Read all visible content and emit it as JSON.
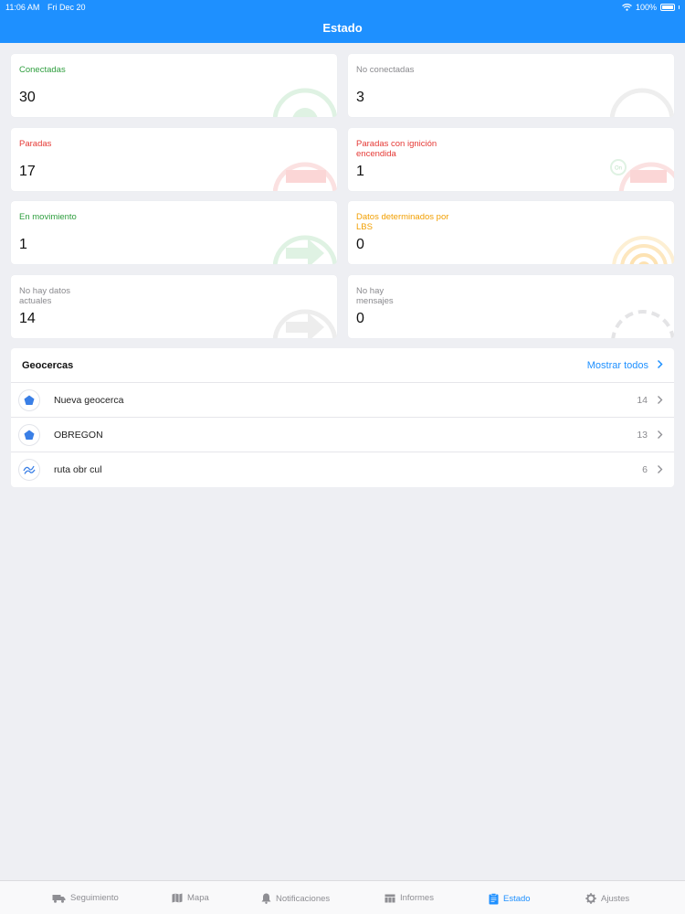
{
  "status_bar": {
    "time": "11:06 AM",
    "date": "Fri Dec 20",
    "battery": "100%"
  },
  "header": {
    "title": "Estado"
  },
  "cards": [
    {
      "label": "Conectadas",
      "value": "30",
      "color": "#2e9e3e"
    },
    {
      "label": "No conectadas",
      "value": "3",
      "color": "#8a8a8e"
    },
    {
      "label": "Paradas",
      "value": "17",
      "color": "#e53935"
    },
    {
      "label": "Paradas con ignición encendida",
      "value": "1",
      "color": "#e53935"
    },
    {
      "label": "En movimiento",
      "value": "1",
      "color": "#2e9e3e"
    },
    {
      "label": "Datos determinados por LBS",
      "value": "0",
      "color": "#f29f00"
    },
    {
      "label": "No hay datos actuales",
      "value": "14",
      "color": "#8a8a8e"
    },
    {
      "label": "No hay mensajes",
      "value": "0",
      "color": "#8a8a8e"
    }
  ],
  "geofences": {
    "title": "Geocercas",
    "show_all": "Mostrar todos",
    "items": [
      {
        "name": "Nueva geocerca",
        "count": "14",
        "icon": "polygon-icon"
      },
      {
        "name": "OBREGON",
        "count": "13",
        "icon": "polygon-icon"
      },
      {
        "name": "ruta obr cul",
        "count": "6",
        "icon": "route-icon"
      }
    ]
  },
  "tabs": [
    {
      "label": "Seguimiento",
      "icon": "truck-icon"
    },
    {
      "label": "Mapa",
      "icon": "map-icon"
    },
    {
      "label": "Notificaciones",
      "icon": "bell-icon"
    },
    {
      "label": "Informes",
      "icon": "table-icon"
    },
    {
      "label": "Estado",
      "icon": "clipboard-icon",
      "active": true
    },
    {
      "label": "Ajustes",
      "icon": "gear-icon"
    }
  ],
  "colors": {
    "accent": "#1e90ff",
    "green": "#2e9e3e",
    "red": "#e53935",
    "orange": "#f29f00",
    "gray": "#8a8a8e"
  }
}
